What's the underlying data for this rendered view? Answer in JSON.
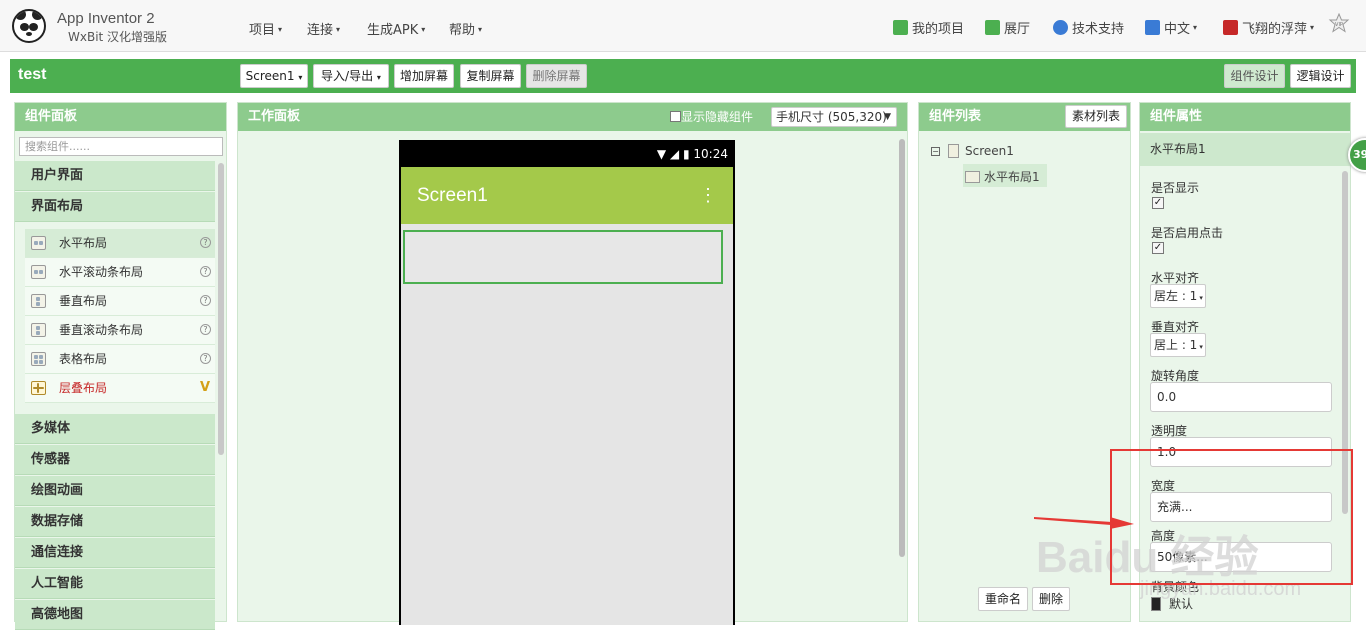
{
  "header": {
    "brand_title": "App Inventor 2",
    "brand_subtitle": "WxBit 汉化增强版",
    "menus": [
      "项目",
      "连接",
      "生成APK",
      "帮助"
    ],
    "right_menus": [
      "我的项目",
      "展厅",
      "技术支持",
      "中文",
      "飞翔的浮萍"
    ],
    "vip_label": "VIP"
  },
  "project_bar": {
    "project_name": "test",
    "screen_select": "Screen1",
    "import_export": "导入/导出",
    "add_screen": "增加屏幕",
    "copy_screen": "复制屏幕",
    "delete_screen": "删除屏幕",
    "designer": "组件设计",
    "blocks": "逻辑设计"
  },
  "palette": {
    "title": "组件面板",
    "search_placeholder": "搜索组件......",
    "categories_top": [
      "用户界面",
      "界面布局"
    ],
    "layout_items": [
      "水平布局",
      "水平滚动条布局",
      "垂直布局",
      "垂直滚动条布局",
      "表格布局",
      "层叠布局"
    ],
    "new_marker": "V",
    "help_marker": "?",
    "categories_bottom": [
      "多媒体",
      "传感器",
      "绘图动画",
      "数据存储",
      "通信连接",
      "人工智能",
      "高德地图"
    ]
  },
  "viewer": {
    "title": "工作面板",
    "show_hidden": "显示隐藏组件",
    "size_select": "手机尺寸 (505,320)",
    "status_time": "10:24",
    "screen_title": "Screen1"
  },
  "components": {
    "title": "组件列表",
    "media_button": "素材列表",
    "tree": [
      "Screen1",
      "水平布局1"
    ],
    "rename": "重命名",
    "delete": "删除"
  },
  "properties": {
    "title": "组件属性",
    "component_name": "水平布局1",
    "visible_label": "是否显示",
    "enabled_label": "是否启用点击",
    "align_h_label": "水平对齐",
    "align_h_value": "居左 : 1",
    "align_v_label": "垂直对齐",
    "align_v_value": "居上 : 1",
    "rotation_label": "旋转角度",
    "rotation_value": "0.0",
    "opacity_label": "透明度",
    "opacity_value": "1.0",
    "width_label": "宽度",
    "width_value": "充满...",
    "height_label": "高度",
    "height_value": "50像素...",
    "bgcolor_label": "背景颜色",
    "bgcolor_value": "默认"
  },
  "overlay": {
    "badge": "39",
    "watermark": "Baidu 经验",
    "watermark_url": "jingyan.baidu.com"
  },
  "colors": {
    "project_bar": "#4caf50",
    "panel_header": "#8dcb8d",
    "phone_titlebar": "#a4c94a",
    "annotation": "#e53935"
  }
}
